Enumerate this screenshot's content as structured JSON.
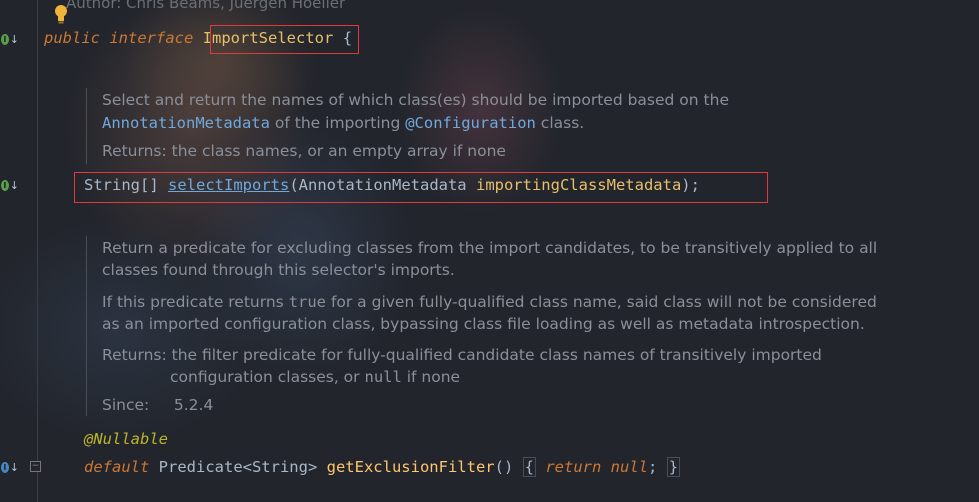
{
  "header": {
    "author_text": "Author:   Chris Beams, Juergen Hoeller"
  },
  "line1": {
    "kw1": "public",
    "kw2": "interface",
    "name": "ImportSelector",
    "brace": "{"
  },
  "doc1": {
    "l1": "Select and return the names of which class(es) should be imported based on the",
    "l2a": "AnnotationMetadata",
    "l2b": " of the importing ",
    "l2c": "@Configuration",
    "l2d": " class.",
    "l3": "Returns: the class names, or an empty array if none"
  },
  "method1": {
    "ret": "String[] ",
    "name": "selectImports",
    "open": "(",
    "ptype": "AnnotationMetadata ",
    "pname": "importingClassMetadata",
    "close": ");"
  },
  "doc2": {
    "l1": "Return a predicate for excluding classes from the import candidates, to be transitively applied to all",
    "l2": "classes found through this selector's imports.",
    "l3a": "If this predicate returns ",
    "l3b": "true",
    "l3c": " for a given fully-qualified class name, said class will not be considered",
    "l4": "as an imported configuration class, bypassing class file loading as well as metadata introspection.",
    "l5": "Returns: the filter predicate for fully-qualified candidate class names of transitively imported",
    "l6a": "configuration classes, or ",
    "l6b": "null",
    "l6c": " if none",
    "l7": "Since:     5.2.4"
  },
  "method2": {
    "annotation": "@Nullable",
    "kw": "default",
    "type": " Predicate<String> ",
    "name": "getExclusionFilter",
    "parens": "()",
    "body_open": "{",
    "ret_kw": "return",
    "null_kw": "null",
    "semi": ";",
    "body_close": "}"
  },
  "gutter": {
    "impl_badge": "I",
    "override_badge": "I",
    "down_arrow": "↓",
    "fold_symbol": "−"
  },
  "colors": {
    "keyword": "#cc7832",
    "highlight_box": "#e03a3a",
    "link": "#6fa8dc"
  }
}
